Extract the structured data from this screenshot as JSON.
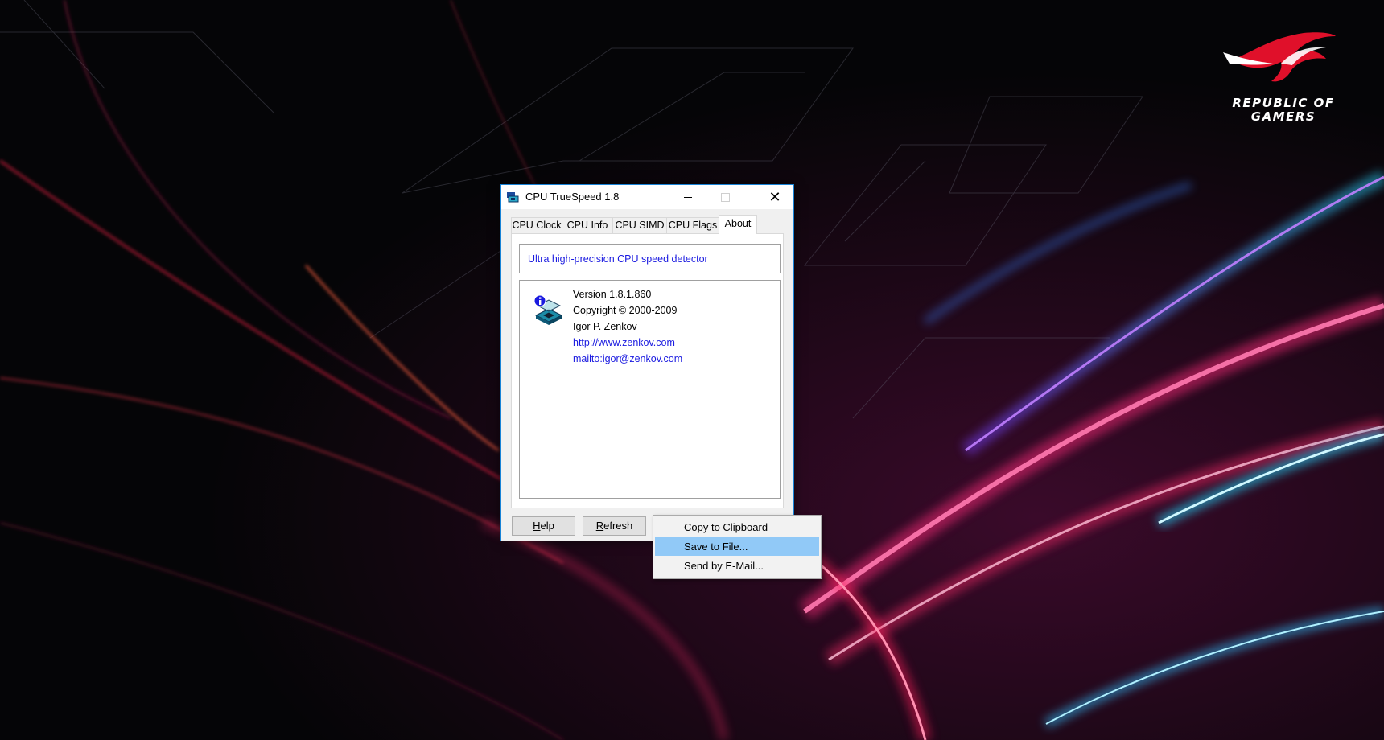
{
  "window": {
    "title": "CPU TrueSpeed 1.8",
    "close_glyph": "✕"
  },
  "tabs": [
    {
      "label": "CPU Clock",
      "active": false
    },
    {
      "label": "CPU Info",
      "active": false
    },
    {
      "label": "CPU SIMD",
      "active": false
    },
    {
      "label": "CPU Flags",
      "active": false
    },
    {
      "label": "About",
      "active": true
    }
  ],
  "about": {
    "tagline": "Ultra high-precision CPU speed detector",
    "version": "Version 1.8.1.860",
    "copyright": "Copyright © 2000-2009",
    "author": "Igor P. Zenkov",
    "website": "http://www.zenkov.com",
    "email": "mailto:igor@zenkov.com"
  },
  "buttons": {
    "help_prefix": "",
    "help_accel": "H",
    "help_rest": "elp",
    "refresh_accel": "R",
    "refresh_rest": "efresh"
  },
  "context_menu": {
    "items": [
      {
        "label": "Copy to Clipboard",
        "highlighted": false
      },
      {
        "label": "Save to File...",
        "highlighted": true
      },
      {
        "label": "Send by E-Mail...",
        "highlighted": false
      }
    ]
  },
  "wallpaper": {
    "brand_line1": "REPUBLIC OF",
    "brand_line2": "GAMERS",
    "logo_color": "#e0102a"
  },
  "colors": {
    "link": "#1a1ae0",
    "window_border": "#1883d7",
    "menu_highlight": "#91c9f7"
  },
  "icons": [
    "app-cpu-icon",
    "minimize-icon",
    "maximize-icon",
    "close-icon",
    "about-info-cpu-icon",
    "rog-eye-logo"
  ]
}
